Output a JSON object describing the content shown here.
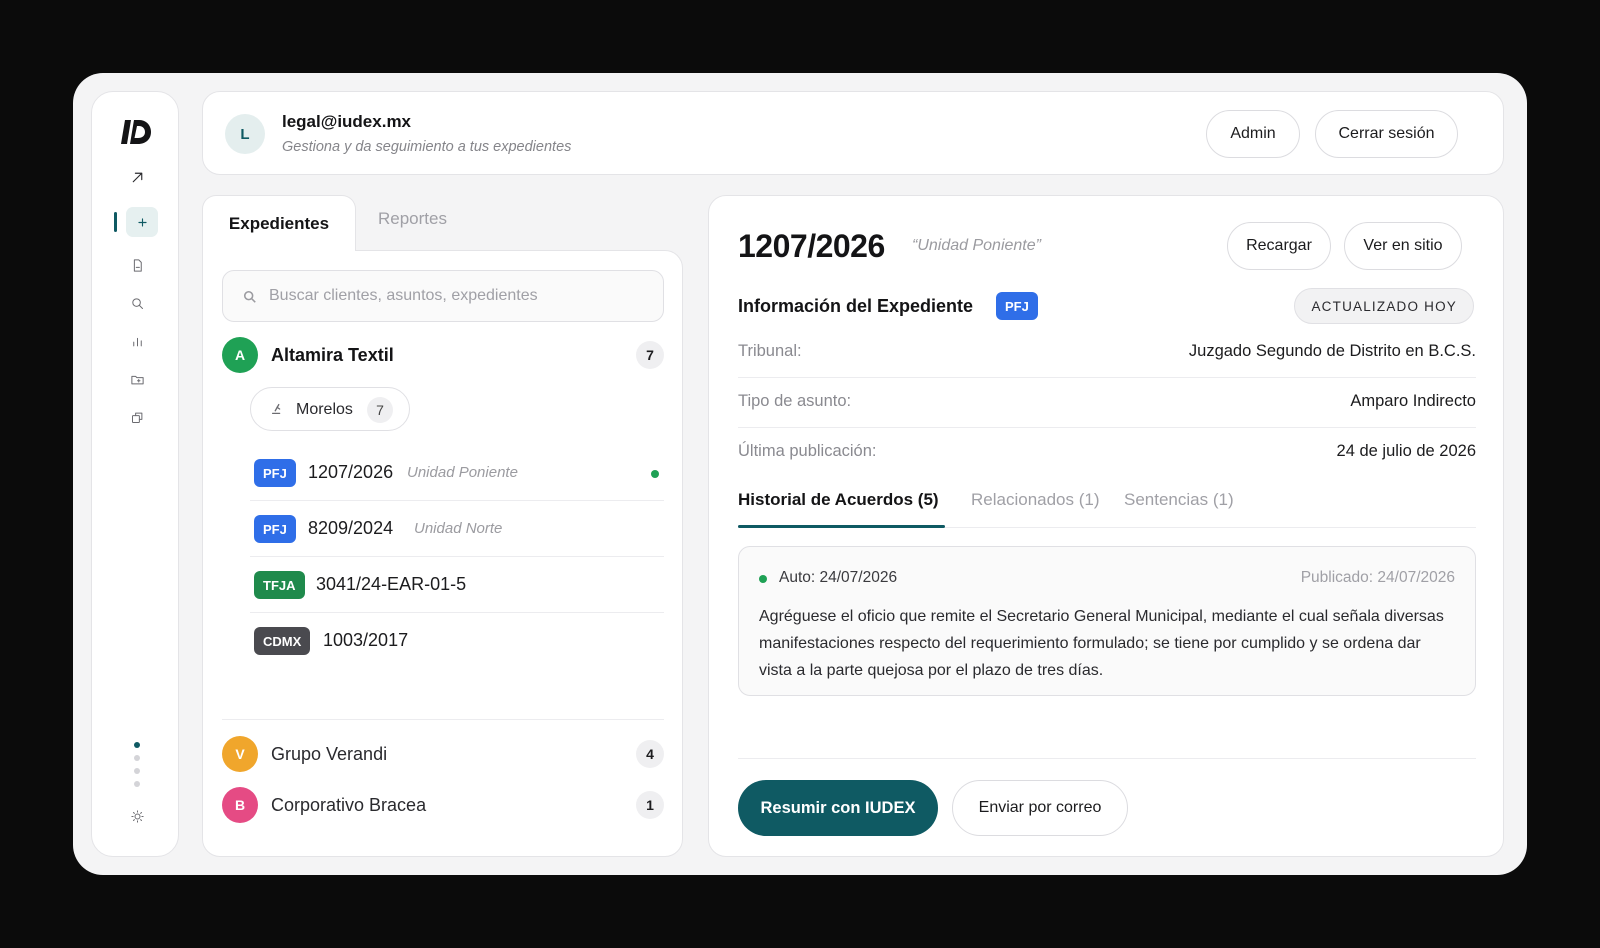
{
  "header": {
    "avatar_initial": "L",
    "email": "legal@iudex.mx",
    "subtitle": "Gestiona y da seguimiento a tus expedientes",
    "admin_label": "Admin",
    "logout_label": "Cerrar sesión"
  },
  "sidebar": {
    "items": [
      "logo-icon",
      "arrow-up-right-icon",
      "plus-icon",
      "document-icon",
      "search-icon",
      "bar-chart-icon",
      "folder-icon",
      "copy-icon",
      "sun-icon"
    ],
    "active": "plus-icon"
  },
  "left": {
    "tabs": [
      {
        "label": "Expedientes",
        "active": true
      },
      {
        "label": "Reportes",
        "active": false
      }
    ],
    "search_placeholder": "Buscar clientes, asuntos, expedientes",
    "clients": [
      {
        "initial": "A",
        "name": "Altamira Textil",
        "count": "7",
        "color": "#1fa155",
        "expanded": true
      },
      {
        "initial": "V",
        "name": "Grupo Verandi",
        "count": "4",
        "color": "#f0a62c"
      },
      {
        "initial": "B",
        "name": "Corporativo Bracea",
        "count": "1",
        "color": "#e54b84"
      }
    ],
    "group": {
      "label": "Morelos",
      "count": "7"
    },
    "cases": [
      {
        "badge": "PFJ",
        "number": "1207/2026",
        "unit": "Unidad Poniente",
        "active": true
      },
      {
        "badge": "PFJ",
        "number": "8209/2024",
        "unit": "Unidad Norte"
      },
      {
        "badge": "TFJA",
        "number": "3041/24-EAR-01-5",
        "unit": ""
      },
      {
        "badge": "CDMX",
        "number": "1003/2017",
        "unit": ""
      }
    ]
  },
  "detail": {
    "number": "1207/2026",
    "quote": "“Unidad Poniente”",
    "reload_label": "Recargar",
    "site_label": "Ver en sitio",
    "info_title": "Información del Expediente",
    "info_badge": "PFJ",
    "status": "ACTUALIZADO HOY",
    "fields": [
      {
        "key": "Tribunal:",
        "value": "Juzgado Segundo de Distrito en B.C.S."
      },
      {
        "key": "Tipo de asunto:",
        "value": "Amparo Indirecto"
      },
      {
        "key": "Última publicación:",
        "value": "24 de julio de 2026"
      }
    ],
    "tabs": [
      "Historial de Acuerdos (5)",
      "Relacionados (1)",
      "Sentencias (1)"
    ],
    "entry": {
      "auto": "Auto: 24/07/2026",
      "published": "Publicado: 24/07/2026",
      "text": "Agréguese el oficio que remite el Secretario General Municipal, mediante el cual señala diversas manifestaciones respecto del requerimiento formulado; se tiene por cumplido y se ordena dar vista a la parte quejosa por el plazo de tres días."
    },
    "summarize_label": "Resumir con IUDEX",
    "email_label": "Enviar por correo"
  },
  "colors": {
    "accent": "#0f5a63",
    "pfj": "#2f6ee8",
    "tfja": "#1f8a4c",
    "cdmx": "#4a4a4f"
  }
}
